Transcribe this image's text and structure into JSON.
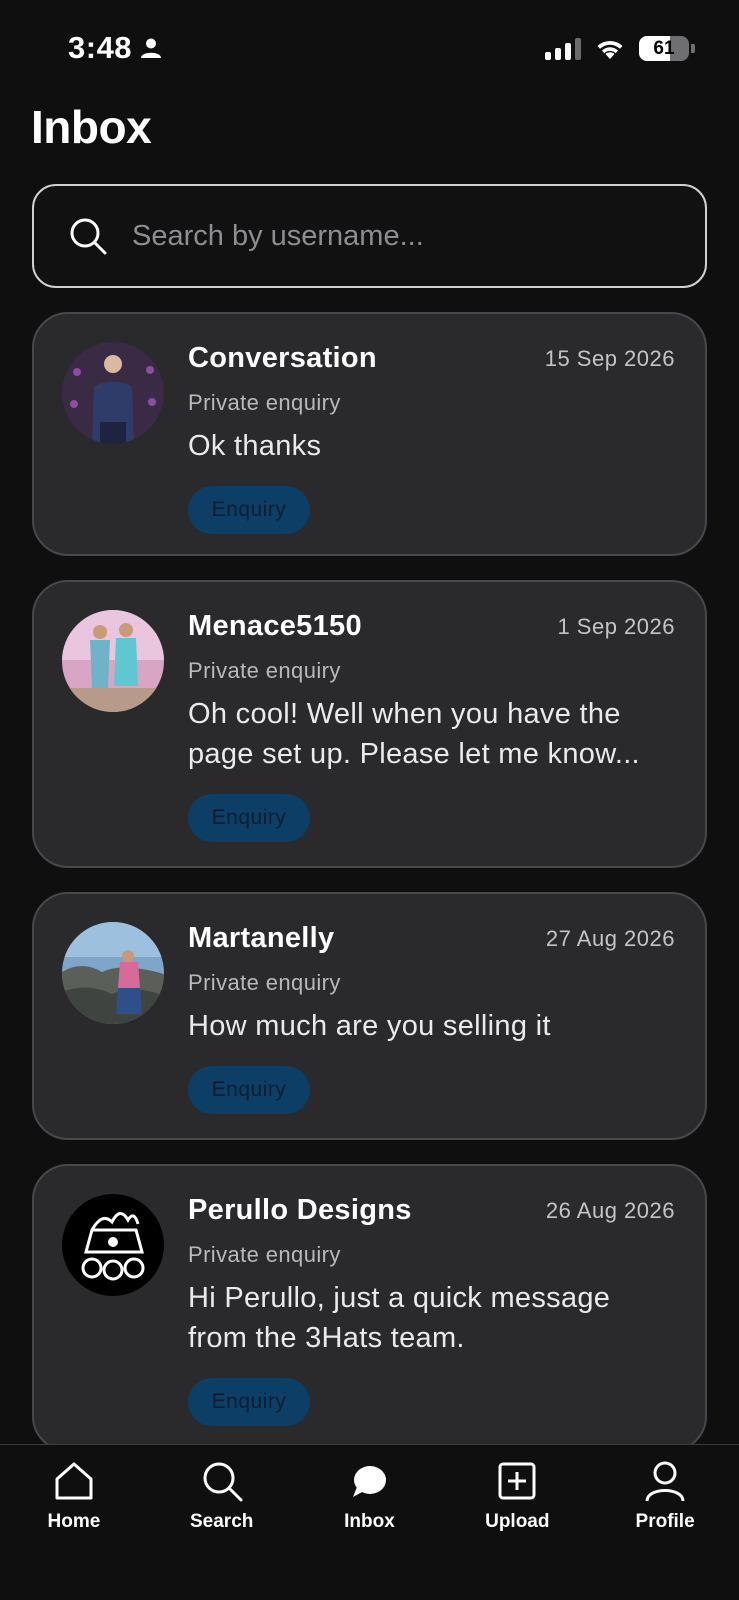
{
  "status_bar": {
    "time": "3:48",
    "battery_level": "61",
    "icons": [
      "person-icon",
      "signal-icon",
      "wifi-icon",
      "battery-icon"
    ]
  },
  "header": {
    "title": "Inbox"
  },
  "search": {
    "placeholder": "Search by username...",
    "value": ""
  },
  "conversations": [
    {
      "name": "Conversation",
      "date": "15 Sep 2026",
      "subtitle": "Private enquiry",
      "message": "Ok thanks",
      "badge": "Enquiry"
    },
    {
      "name": "Menace5150",
      "date": "1 Sep 2026",
      "subtitle": "Private enquiry",
      "message": "Oh cool! Well when you have the page set up. Please let me know...",
      "badge": "Enquiry"
    },
    {
      "name": "Martanelly",
      "date": "27 Aug 2026",
      "subtitle": "Private enquiry",
      "message": "How much are you selling it",
      "badge": "Enquiry"
    },
    {
      "name": "Perullo Designs",
      "date": "26 Aug 2026",
      "subtitle": "Private enquiry",
      "message": "Hi Perullo, just a quick message from the 3Hats team.",
      "badge": "Enquiry"
    }
  ],
  "nav": {
    "items": [
      {
        "label": "Home",
        "icon": "home-icon"
      },
      {
        "label": "Search",
        "icon": "search-icon"
      },
      {
        "label": "Inbox",
        "icon": "chat-bubble-icon"
      },
      {
        "label": "Upload",
        "icon": "plus-square-icon"
      },
      {
        "label": "Profile",
        "icon": "user-icon"
      }
    ]
  },
  "colors": {
    "background": "#0f0f10",
    "card": "#2a2a2d",
    "badge": "#0d3e66"
  }
}
